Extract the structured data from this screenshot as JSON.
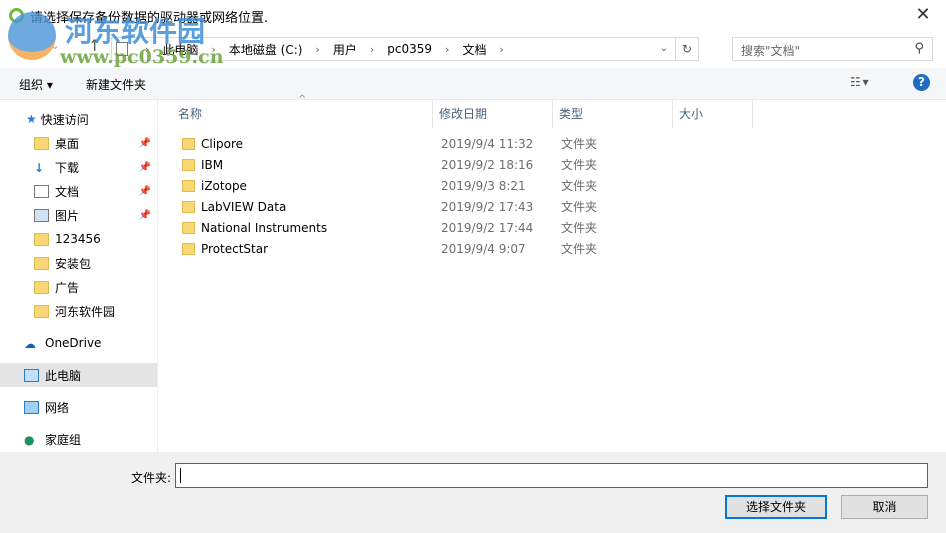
{
  "title": "请选择保存备份数据的驱动器或网络位置.",
  "watermark": {
    "name": "河东软件园",
    "url": "www.pc0359.cn"
  },
  "address": {
    "crumbs": [
      "此电脑",
      "本地磁盘 (C:)",
      "用户",
      "pc0359",
      "文档"
    ]
  },
  "search": {
    "placeholder": "搜索\"文档\""
  },
  "toolbar": {
    "organize": "组织 ▾",
    "new_folder": "新建文件夹",
    "help": "?"
  },
  "sidebar": {
    "quick_access": "快速访问",
    "items": [
      "桌面",
      "下载",
      "文档",
      "图片",
      "123456",
      "安装包",
      "广告",
      "河东软件园"
    ],
    "onedrive": "OneDrive",
    "this_pc": "此电脑",
    "network": "网络",
    "homegroup": "家庭组"
  },
  "columns": [
    "名称",
    "修改日期",
    "类型",
    "大小"
  ],
  "files": [
    {
      "name": "Clipore",
      "date": "2019/9/4 11:32",
      "type": "文件夹"
    },
    {
      "name": "IBM",
      "date": "2019/9/2 18:16",
      "type": "文件夹"
    },
    {
      "name": "iZotope",
      "date": "2019/9/3 8:21",
      "type": "文件夹"
    },
    {
      "name": "LabVIEW Data",
      "date": "2019/9/2 17:43",
      "type": "文件夹"
    },
    {
      "name": "National Instruments",
      "date": "2019/9/2 17:44",
      "type": "文件夹"
    },
    {
      "name": "ProtectStar",
      "date": "2019/9/4 9:07",
      "type": "文件夹"
    }
  ],
  "bottom": {
    "folder_label": "文件夹:",
    "folder_value": "",
    "ok": "选择文件夹",
    "cancel": "取消"
  }
}
